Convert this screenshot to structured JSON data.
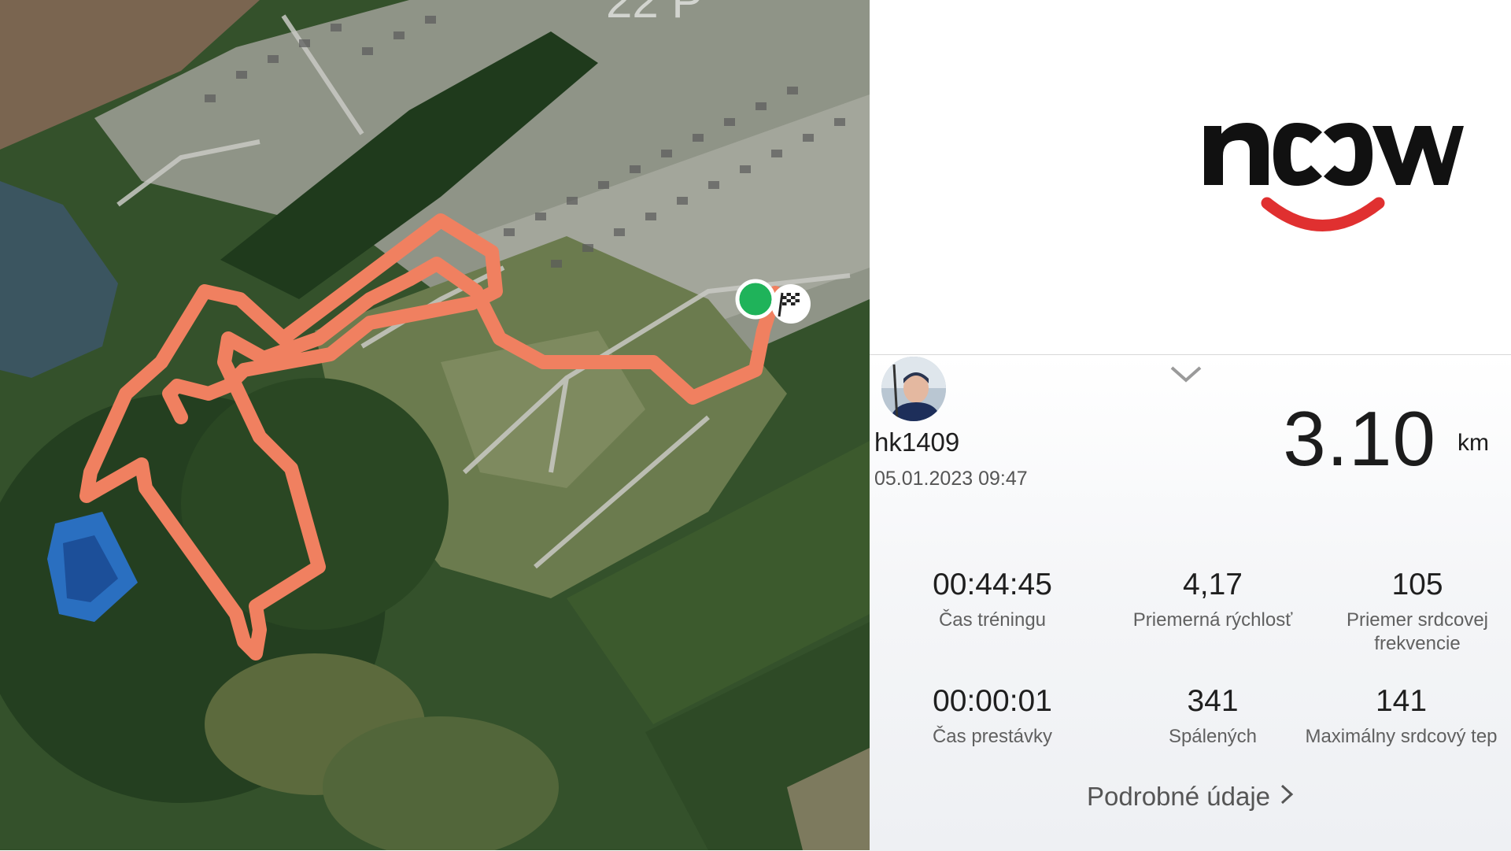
{
  "map": {
    "route_color": "#F08060",
    "start_marker_color": "#1FB35A",
    "finish_icon": "checkered-flag-icon",
    "partial_label": "22 P"
  },
  "logo": {
    "text": "noow",
    "colors": {
      "letters": "#111111",
      "accent": "#E03030"
    }
  },
  "activity": {
    "username": "hk1409",
    "datetime": "05.01.2023 09:47",
    "distance": "3.10",
    "distance_unit": "km",
    "stats": [
      {
        "value": "00:44:45",
        "label": "Čas tréningu"
      },
      {
        "value": "4,17",
        "label": "Priemerná rýchlosť"
      },
      {
        "value": "105",
        "label": "Priemer srdcovej frekvencie"
      },
      {
        "value": "00:00:01",
        "label": "Čas prestávky"
      },
      {
        "value": "341",
        "label": "Spálených"
      },
      {
        "value": "141",
        "label": "Maximálny srdcový tep"
      }
    ],
    "details_label": "Podrobné údaje"
  }
}
